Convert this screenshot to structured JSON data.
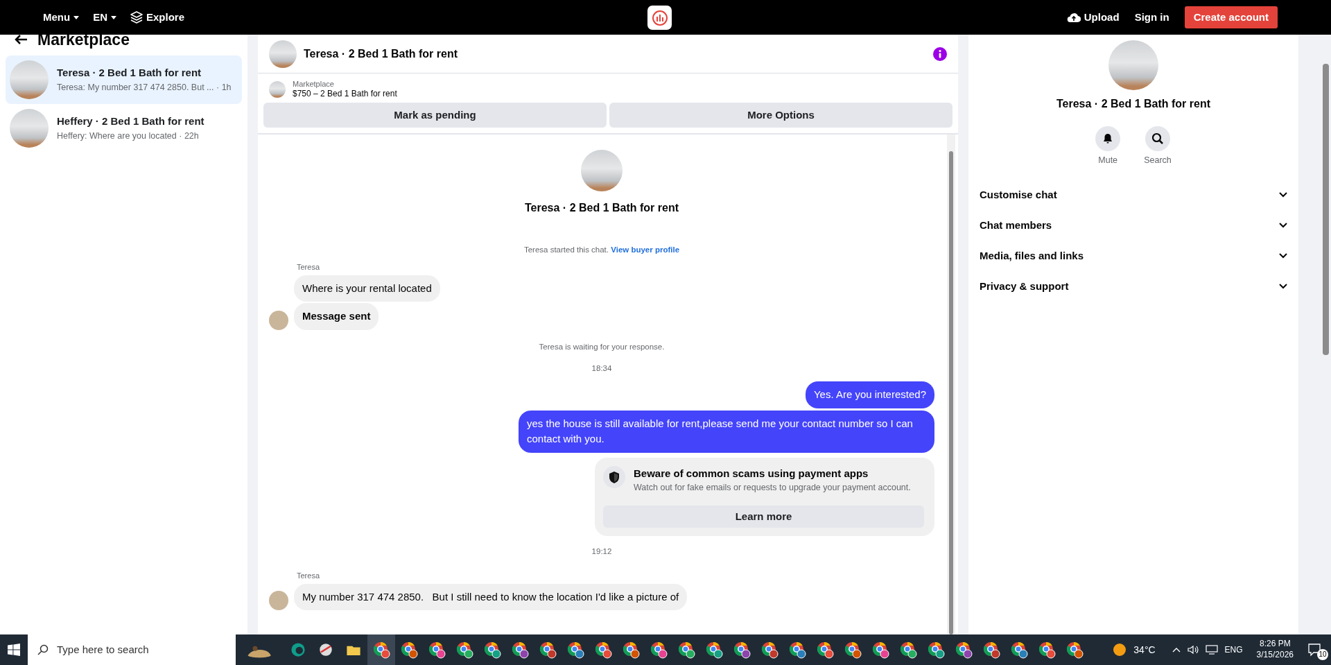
{
  "topbar": {
    "nav": [
      {
        "label": "Menu",
        "kind": "dropdown"
      },
      {
        "label": "EN",
        "kind": "dropdown"
      },
      {
        "label": "Explore",
        "kind": "layers"
      }
    ],
    "upload": "Upload",
    "sign_in": "Sign in",
    "create_account": "Create account"
  },
  "sidebar": {
    "title": "Marketplace",
    "conversations": [
      {
        "title": "Teresa · 2 Bed 1 Bath for rent",
        "preview": "Teresa: My number 317 474 2850. But ... · 1h",
        "selected": true
      },
      {
        "title": "Heffery · 2 Bed 1 Bath for rent",
        "preview": "Heffery: Where are you located · 22h",
        "selected": false
      }
    ]
  },
  "chat": {
    "title": "Teresa · 2 Bed 1 Bath for rent",
    "listing": {
      "source": "Marketplace",
      "title": "$750 – 2 Bed 1 Bath for rent"
    },
    "actions": [
      "Mark as pending",
      "More Options"
    ],
    "intro_title": "Teresa · 2 Bed 1 Bath for rent",
    "messages": [
      {
        "kind": "notice",
        "text": "Teresa started this chat.",
        "link": "View buyer profile"
      },
      {
        "kind": "sender",
        "text": "Teresa"
      },
      {
        "kind": "incoming",
        "text": "Where is your rental located",
        "bold": false,
        "avatar": false
      },
      {
        "kind": "incoming",
        "text": "Message sent",
        "bold": true,
        "avatar": true
      },
      {
        "kind": "notice",
        "text": "Teresa is waiting for your response."
      },
      {
        "kind": "time",
        "text": "18:34"
      },
      {
        "kind": "outgoing",
        "text": "Yes. Are you interested?"
      },
      {
        "kind": "outgoing",
        "text": "yes the house is still available for rent,please send me your contact number so I can contact with you."
      },
      {
        "kind": "warning",
        "title": "Beware of common scams using payment apps",
        "text": "Watch out for fake emails or requests to upgrade your payment account.",
        "button": "Learn more"
      },
      {
        "kind": "time",
        "text": "19:12"
      },
      {
        "kind": "sender",
        "text": "Teresa"
      },
      {
        "kind": "incoming",
        "text": "My number 317 474 2850.   But I still need to know the location I'd like a picture of",
        "bold": false,
        "avatar": true
      }
    ]
  },
  "details": {
    "title": "Teresa · 2 Bed 1 Bath for rent",
    "actions": [
      {
        "label": "Mute",
        "kind": "bell"
      },
      {
        "label": "Search",
        "kind": "search"
      }
    ],
    "sections": [
      {
        "label": "Customise chat",
        "expanded": false
      },
      {
        "label": "Chat members",
        "expanded": false
      },
      {
        "label": "Media, files and links",
        "expanded": false
      },
      {
        "label": "Privacy & support",
        "expanded": false
      }
    ]
  },
  "taskbar": {
    "search_placeholder": "Type here to search",
    "temperature": "34°C",
    "language": "ENG",
    "time": "8:26 PM",
    "date": "3/15/2026",
    "notifications": "10"
  }
}
